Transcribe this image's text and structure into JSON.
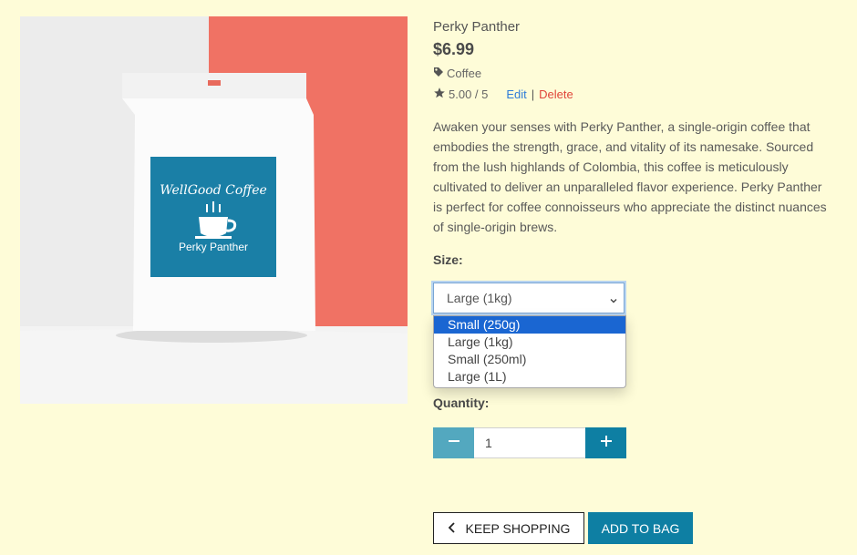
{
  "product": {
    "name": "Perky Panther",
    "price": "$6.99",
    "category": "Coffee",
    "rating": "5.00 / 5",
    "edit_label": "Edit",
    "separator": "|",
    "delete_label": "Delete",
    "description": "Awaken your senses with Perky Panther, a single-origin coffee that embodies the strength, grace, and vitality of its namesake. Sourced from the lush highlands of Colombia, this coffee is meticulously cultivated to deliver an unparalleled flavor experience. Perky Panther is perfect for coffee connoisseurs who appreciate the distinct nuances of single-origin brews."
  },
  "image": {
    "brand": "WellGood Coffee",
    "label_product": "Perky Panther"
  },
  "size": {
    "label": "Size:",
    "selected": "Large (1kg)",
    "options": [
      "Small (250g)",
      "Large (1kg)",
      "Small (250ml)",
      "Large (1L)"
    ],
    "highlighted_option": "Small (250g)"
  },
  "quantity": {
    "label": "Quantity:",
    "value": "1",
    "minus_icon": "minus-icon",
    "plus_icon": "plus-icon"
  },
  "actions": {
    "keep_shopping": "KEEP SHOPPING",
    "add_to_bag": "ADD TO BAG"
  },
  "colors": {
    "background": "#fefcd8",
    "accent": "#0e7fa3",
    "accent_light": "#53a8bf",
    "link": "#2f7cd8",
    "danger": "#e0463a",
    "selected_option": "#1a66d2"
  }
}
